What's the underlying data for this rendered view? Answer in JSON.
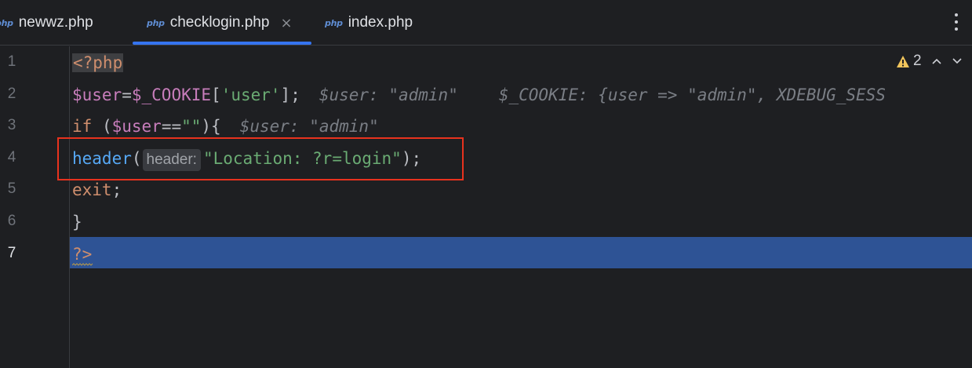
{
  "tabs": [
    {
      "badge": "php",
      "label": "newwz.php"
    },
    {
      "badge": "php",
      "label": "checklogin.php",
      "close": "×"
    },
    {
      "badge": "php",
      "label": "index.php"
    }
  ],
  "inspections": {
    "count": "2"
  },
  "lines": [
    "1",
    "2",
    "3",
    "4",
    "5",
    "6",
    "7"
  ],
  "code": {
    "l1": {
      "open": "<?php"
    },
    "l2": {
      "var": "$user",
      "eq": "=",
      "cookie": "$_COOKIE",
      "lb": "[",
      "key": "'user'",
      "rb": "];",
      "hint1": "$user: \"admin\"",
      "hint2": "$_COOKIE: {user => \"admin\", XDEBUG_SESS"
    },
    "l3": {
      "kw": "if",
      "p1": " (",
      "var": "$user",
      "op": "==",
      "str": "\"\"",
      "p2": "){",
      "hint": "$user: \"admin\""
    },
    "l4": {
      "fn": "header",
      "p1": "(",
      "param": "header:",
      "str": "\"Location: ?r=login\"",
      "p2": ");"
    },
    "l5": {
      "kw": "exit",
      "p": ";"
    },
    "l6": {
      "p": "}"
    },
    "l7": {
      "close": "?>"
    }
  }
}
